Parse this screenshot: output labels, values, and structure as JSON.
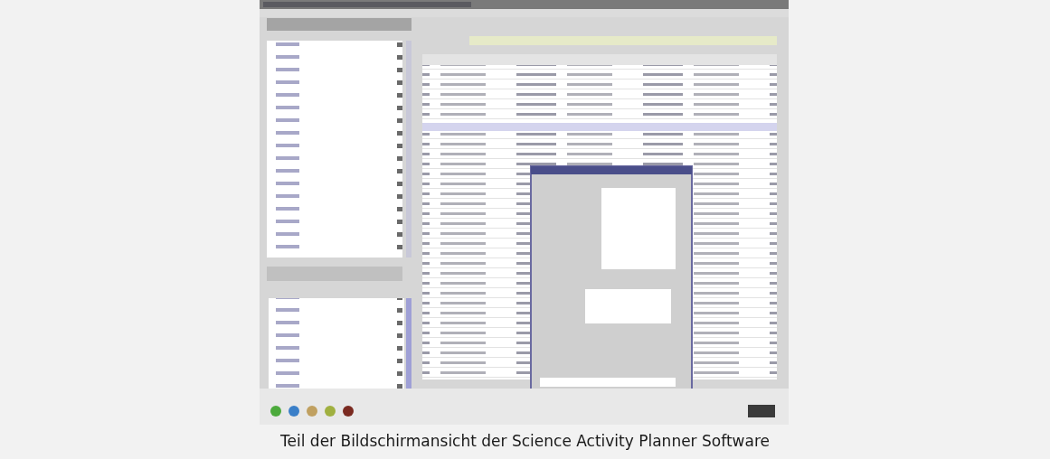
{
  "figure": {
    "caption": "Teil der Bildschirmansicht der Science Activity Planner Software"
  }
}
